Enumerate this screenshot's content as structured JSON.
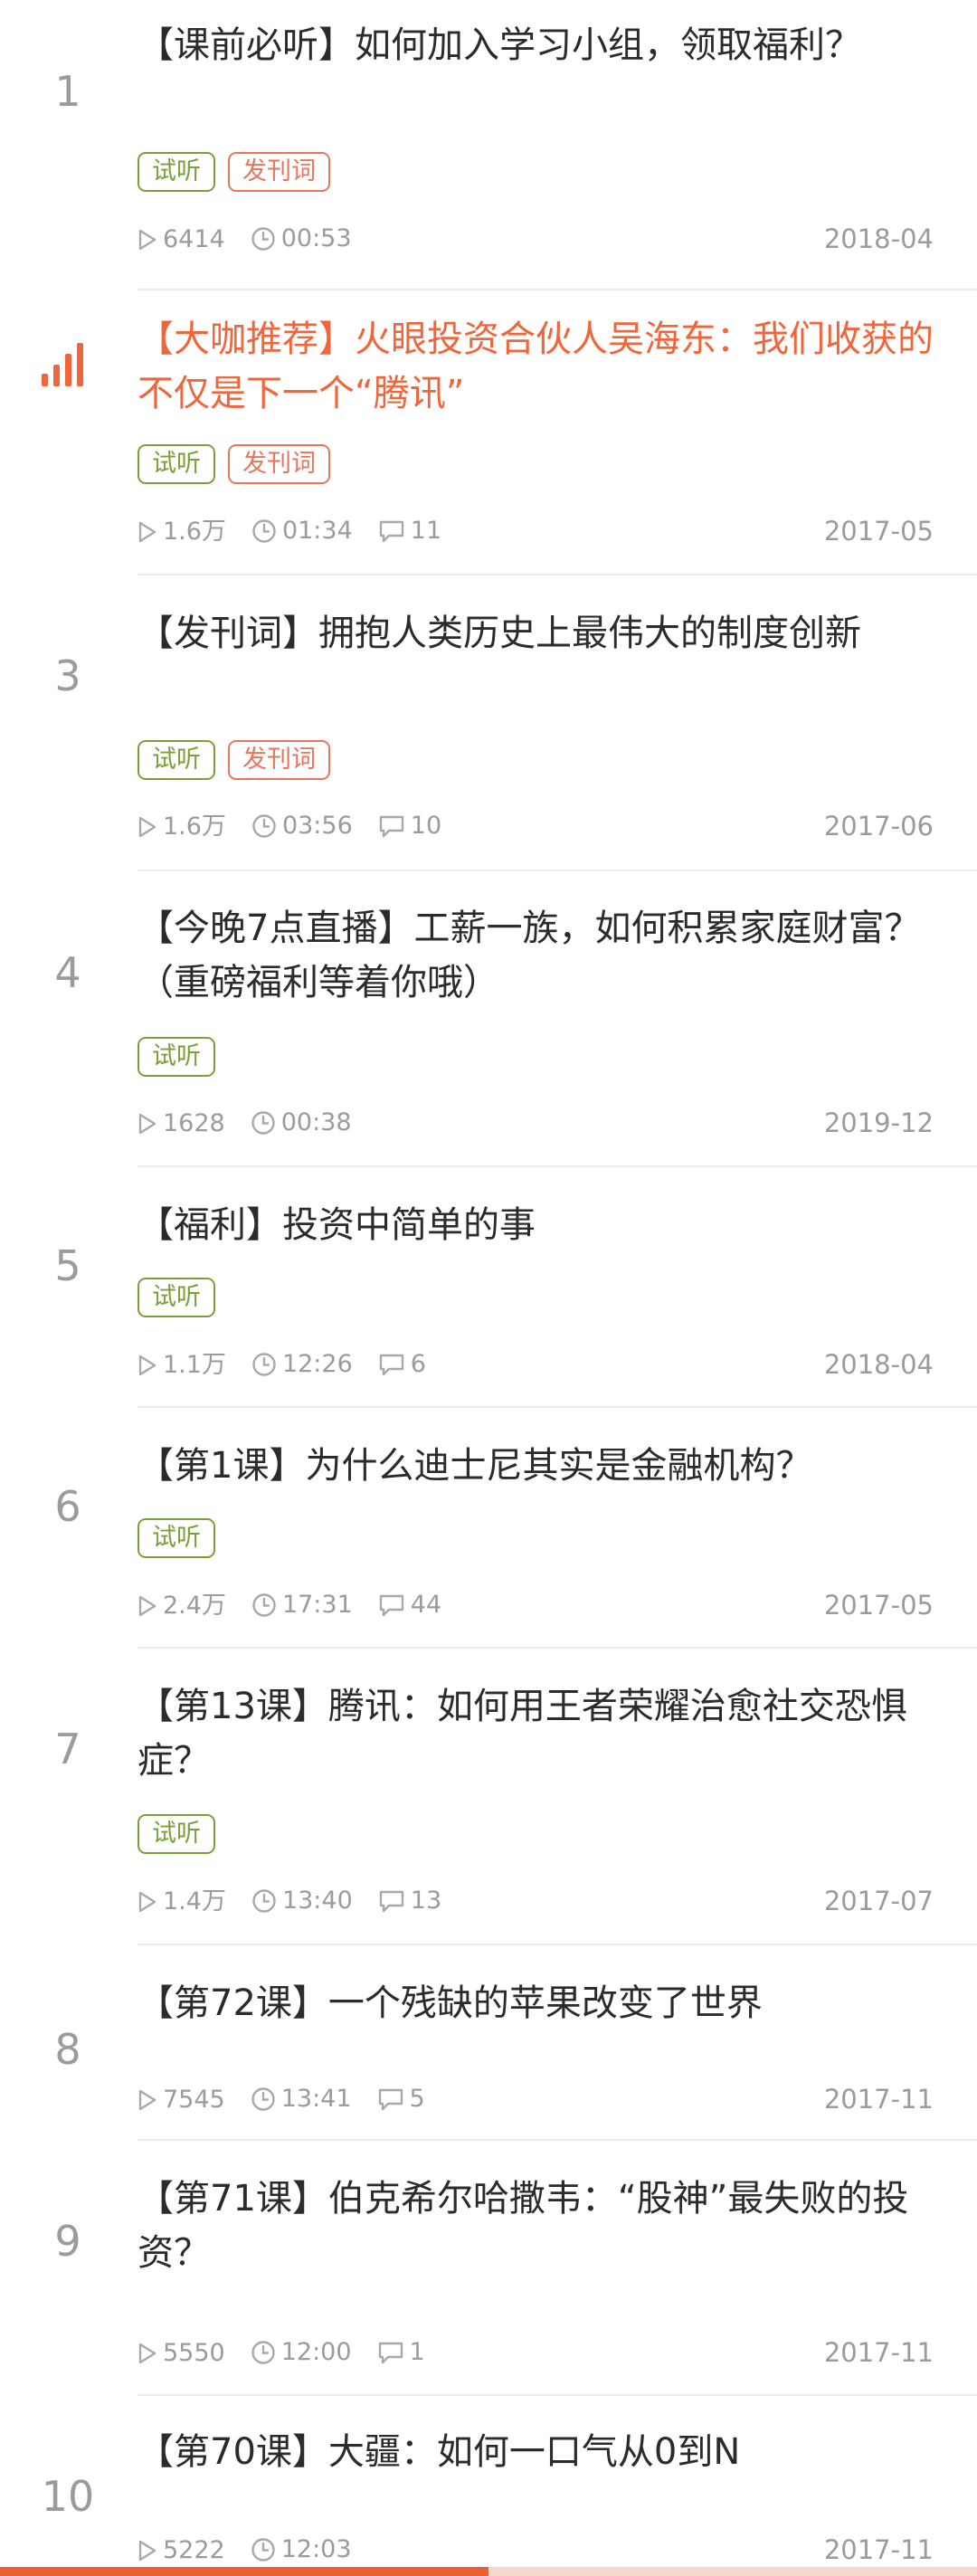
{
  "colors": {
    "accent": "#f0653a",
    "trial": "#7aa03a",
    "intro": "#e7775a",
    "muted": "#9b9b9b"
  },
  "items": [
    {
      "num": "1",
      "title": "【课前必听】如何加入学习小组，领取福利？",
      "tags": [
        "试听",
        "发刊词"
      ],
      "plays": "6414",
      "duration": "00:53",
      "comments": "",
      "date": "2018-04",
      "active": false
    },
    {
      "num": "",
      "title": "【大咖推荐】火眼投资合伙人吴海东：我们收获的不仅是下一个“腾讯”",
      "tags": [
        "试听",
        "发刊词"
      ],
      "plays": "1.6万",
      "duration": "01:34",
      "comments": "11",
      "date": "2017-05",
      "active": true
    },
    {
      "num": "3",
      "title": "【发刊词】拥抱人类历史上最伟大的制度创新",
      "tags": [
        "试听",
        "发刊词"
      ],
      "plays": "1.6万",
      "duration": "03:56",
      "comments": "10",
      "date": "2017-06",
      "active": false
    },
    {
      "num": "4",
      "title": "【今晚7点直播】工薪一族，如何积累家庭财富？（重磅福利等着你哦）",
      "tags": [
        "试听"
      ],
      "plays": "1628",
      "duration": "00:38",
      "comments": "",
      "date": "2019-12",
      "active": false
    },
    {
      "num": "5",
      "title": "【福利】投资中简单的事",
      "tags": [
        "试听"
      ],
      "plays": "1.1万",
      "duration": "12:26",
      "comments": "6",
      "date": "2018-04",
      "active": false
    },
    {
      "num": "6",
      "title": "【第1课】为什么迪士尼其实是金融机构？",
      "tags": [
        "试听"
      ],
      "plays": "2.4万",
      "duration": "17:31",
      "comments": "44",
      "date": "2017-05",
      "active": false
    },
    {
      "num": "7",
      "title": "【第13课】腾讯：如何用王者荣耀治愈社交恐惧症？",
      "tags": [
        "试听"
      ],
      "plays": "1.4万",
      "duration": "13:40",
      "comments": "13",
      "date": "2017-07",
      "active": false
    },
    {
      "num": "8",
      "title": "【第72课】一个残缺的苹果改变了世界",
      "tags": [],
      "plays": "7545",
      "duration": "13:41",
      "comments": "5",
      "date": "2017-11",
      "active": false
    },
    {
      "num": "9",
      "title": "【第71课】伯克希尔哈撒韦：“股神”最失败的投资？",
      "tags": [],
      "plays": "5550",
      "duration": "12:00",
      "comments": "1",
      "date": "2017-11",
      "active": false
    },
    {
      "num": "10",
      "title": "【第70课】大疆：如何一口气从0到N",
      "tags": [],
      "plays": "5222",
      "duration": "12:03",
      "comments": "",
      "date": "2017-11",
      "active": false
    }
  ],
  "progress": 0.5
}
